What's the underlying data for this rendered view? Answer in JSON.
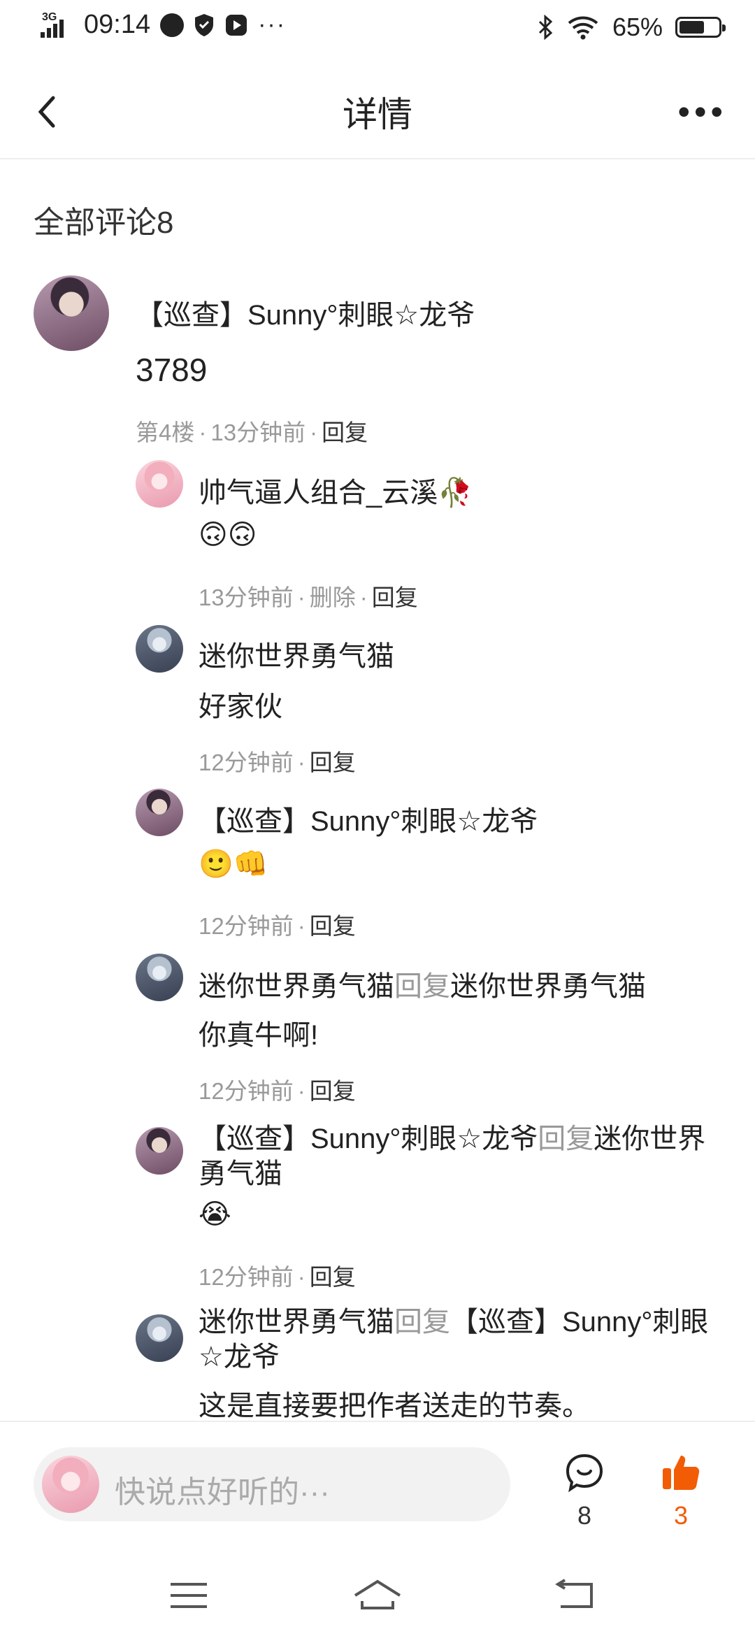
{
  "status_bar": {
    "network": "3G",
    "time": "09:14",
    "more": "···",
    "battery": "65%",
    "battery_level": 0.65
  },
  "navbar": {
    "title": "详情",
    "more": "•••"
  },
  "comments_header": "全部评论8",
  "main_comment": {
    "author": "【巡查】Sunny°刺眼☆龙爷",
    "text": "3789",
    "floor": "第4楼",
    "time": "13分钟前",
    "reply": "回复"
  },
  "replies": [
    {
      "author": "帅气逼人组合_云溪🥀",
      "text": "🙃🙃",
      "time": "13分钟前",
      "delete": "删除",
      "reply": "回复"
    },
    {
      "author": "迷你世界勇气猫",
      "text": "好家伙",
      "time": "12分钟前",
      "reply": "回复"
    },
    {
      "author": "【巡查】Sunny°刺眼☆龙爷",
      "text": "🙂👊",
      "time": "12分钟前",
      "reply": "回复"
    },
    {
      "author": "迷你世界勇气猫",
      "reply_word": "回复",
      "target": "迷你世界勇气猫",
      "text": "你真牛啊!",
      "time": "12分钟前",
      "reply": "回复"
    },
    {
      "author": "【巡查】Sunny°刺眼☆龙爷",
      "reply_word": "回复",
      "target": "迷你世界勇气猫",
      "text": "😭",
      "time": "12分钟前",
      "reply": "回复"
    },
    {
      "author": "迷你世界勇气猫",
      "reply_word": "回复",
      "target": "【巡查】Sunny°刺眼☆龙爷",
      "text": "这是直接要把作者送走的节奏。"
    }
  ],
  "bottom_bar": {
    "placeholder": "快说点好听的···",
    "comment_count": "8",
    "like_count": "3",
    "like_color": "#f25c05"
  }
}
